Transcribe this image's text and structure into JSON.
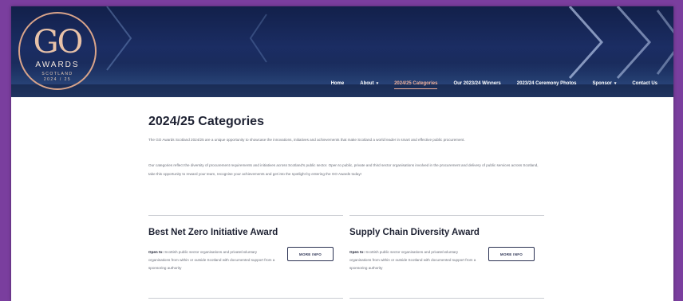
{
  "logo": {
    "mark": "GO",
    "awards": "AWARDS",
    "line1": "SCOTLAND",
    "line2": "2024 / 25"
  },
  "nav": {
    "items": [
      {
        "label": "Home",
        "chevron": false,
        "active": false
      },
      {
        "label": "About",
        "chevron": true,
        "active": false
      },
      {
        "label": "2024/25 Categories",
        "chevron": false,
        "active": true
      },
      {
        "label": "Our 2023/24 Winners",
        "chevron": false,
        "active": false
      },
      {
        "label": "2023/24 Ceremony Photos",
        "chevron": false,
        "active": false
      },
      {
        "label": "Sponsor",
        "chevron": true,
        "active": false
      },
      {
        "label": "Contact Us",
        "chevron": false,
        "active": false
      }
    ]
  },
  "main": {
    "title": "2024/25 Categories",
    "intro": "The GO Awards Scotland 2024/25 are a unique opportunity to showcase the innovations, initiatives and achievements that make Scotland a world leader in smart and effective public procurement.",
    "body": "Our categories reflect the diversity of procurement requirements and initiatives across Scotland's public sector. Open to public, private and third sector organisations involved in the procurement and delivery of public services across Scotland, take this opportunity to reward your team, recognise your achievements and get into the spotlight by entering the GO Awards today!"
  },
  "cards": [
    {
      "title": "Best Net Zero Initiative Award",
      "open_label": "Open to:",
      "open_text": "Scottish public sector organisations and private/voluntary organisations from within or outside Scotland with documented support from a sponsoring authority",
      "button": "MORE INFO"
    },
    {
      "title": "Supply Chain Diversity Award",
      "open_label": "Open to:",
      "open_text": "Scottish public sector organisations and private/voluntary organisations from within or outside Scotland with documented support from a sponsoring authority",
      "button": "MORE INFO"
    }
  ],
  "colors": {
    "frame": "#7a3e9e",
    "hero": "#16284f",
    "accent": "#f0b09a",
    "heading": "#1e2233"
  }
}
